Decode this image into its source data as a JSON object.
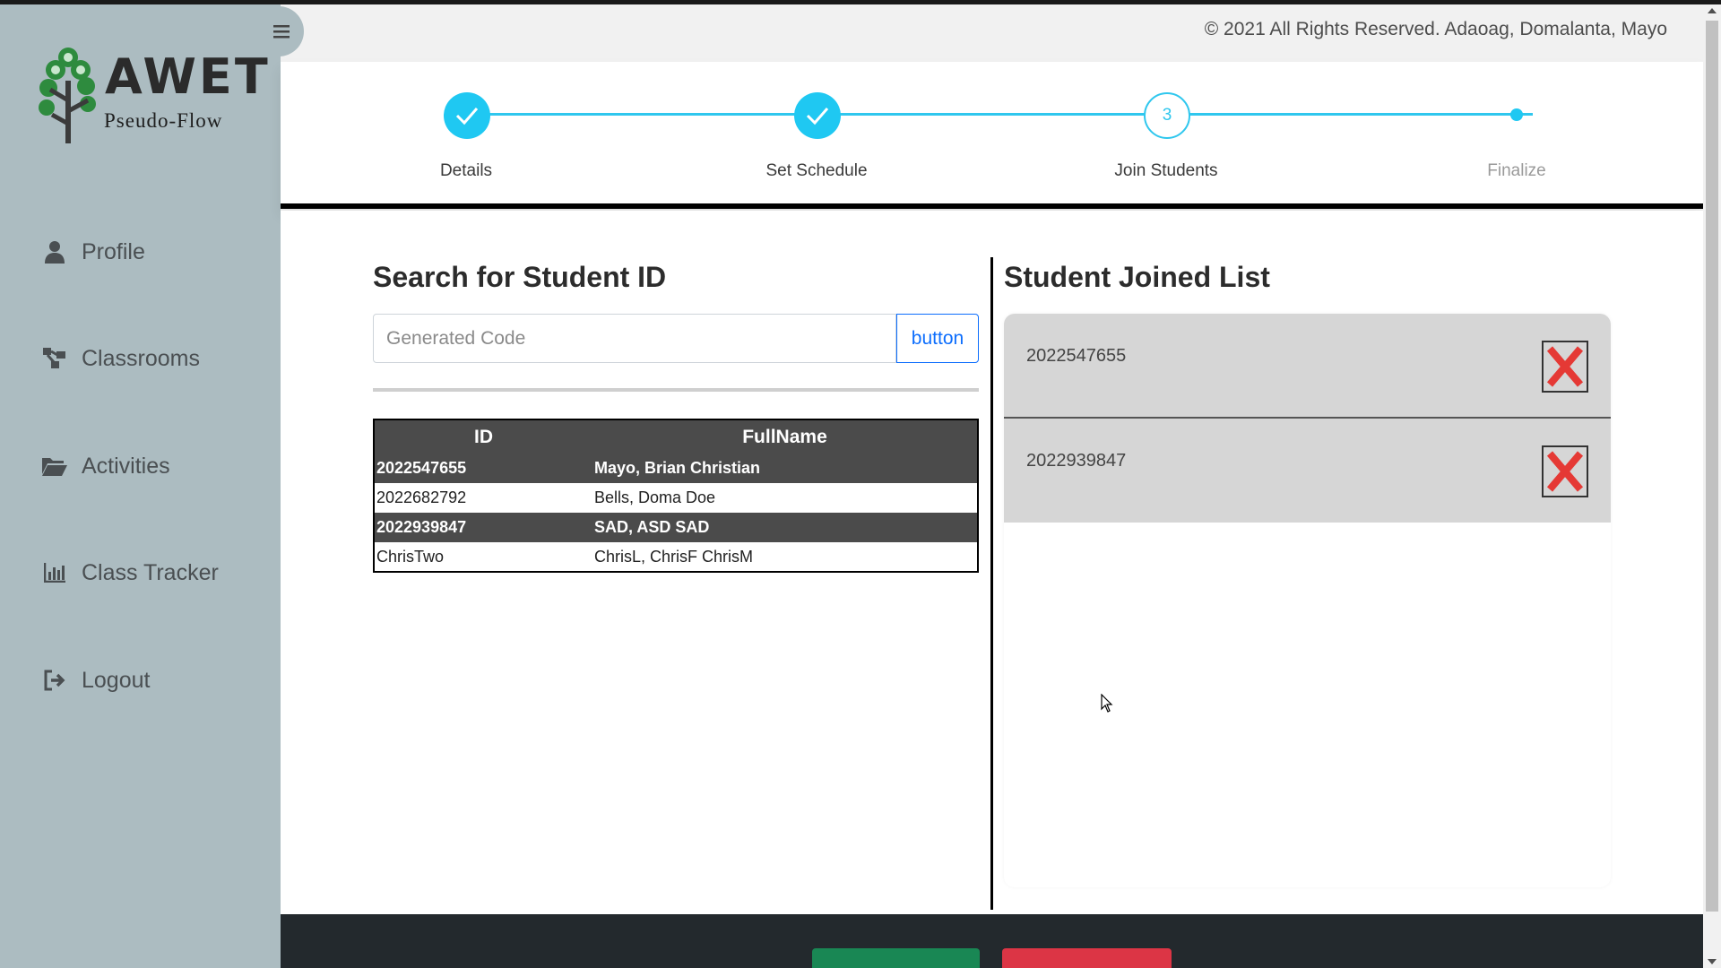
{
  "app": {
    "brand": "AWET",
    "subtitle": "Pseudo-Flow",
    "copyright": "© 2021 All Rights Reserved. Adaoag, Domalanta, Mayo"
  },
  "sidebar": {
    "items": [
      {
        "label": "Profile",
        "icon": "user-icon"
      },
      {
        "label": "Classrooms",
        "icon": "sitemap-icon"
      },
      {
        "label": "Activities",
        "icon": "folder-open-icon"
      },
      {
        "label": "Class Tracker",
        "icon": "bar-chart-icon"
      },
      {
        "label": "Logout",
        "icon": "sign-out-icon"
      }
    ]
  },
  "stepper": {
    "steps": [
      {
        "label": "Details",
        "state": "done"
      },
      {
        "label": "Set Schedule",
        "state": "done"
      },
      {
        "label": "Join Students",
        "state": "current",
        "number": "3"
      },
      {
        "label": "Finalize",
        "state": "pending"
      }
    ]
  },
  "search": {
    "title": "Search for Student ID",
    "placeholder": "Generated Code",
    "button_label": "button"
  },
  "table": {
    "headers": [
      "ID",
      "FullName"
    ],
    "rows": [
      {
        "id": "2022547655",
        "name": "Mayo, Brian Christian",
        "highlight": true
      },
      {
        "id": "2022682792",
        "name": "Bells, Doma Doe",
        "highlight": false
      },
      {
        "id": "2022939847",
        "name": "SAD, ASD SAD",
        "highlight": true
      },
      {
        "id": "ChrisTwo",
        "name": "ChrisL, ChrisF ChrisM",
        "highlight": false
      }
    ]
  },
  "joined": {
    "title": "Student Joined List",
    "items": [
      "2022547655",
      "2022939847"
    ]
  },
  "colors": {
    "sidebar": "#acbcc1",
    "accent": "#1fc8f2",
    "remove": "#e53935",
    "footer": "#23292d",
    "green_button": "#198754",
    "red_button": "#dc3545"
  }
}
